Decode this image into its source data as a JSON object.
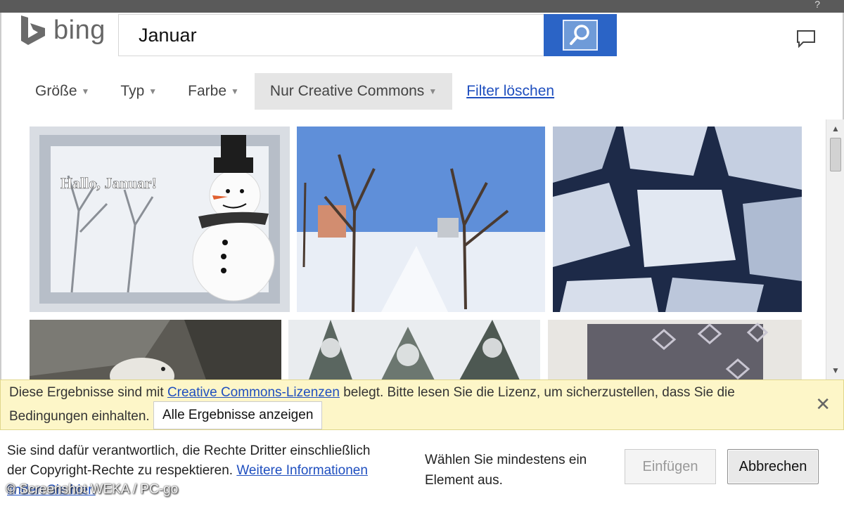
{
  "titlebar": {
    "help_icon": "question-mark-icon"
  },
  "logo": {
    "text": "bing",
    "icon": "bing-logo-mark"
  },
  "search": {
    "value": "Januar",
    "button_icon": "search-icon"
  },
  "header": {
    "feedback_icon": "speech-bubble-icon"
  },
  "filters": {
    "items": [
      {
        "label": "Größe"
      },
      {
        "label": "Typ"
      },
      {
        "label": "Farbe"
      },
      {
        "label": "Nur Creative Commons"
      }
    ],
    "clear_label": "Filter löschen"
  },
  "results": {
    "images": [
      {
        "alt": "Hallo, Januar!"
      },
      {
        "alt": ""
      },
      {
        "alt": ""
      },
      {
        "alt": ""
      },
      {
        "alt": ""
      },
      {
        "alt": ""
      }
    ]
  },
  "notice": {
    "text_before": "Diese Ergebnisse sind mit ",
    "link": "Creative Commons-Lizenzen",
    "text_after": " belegt. Bitte lesen Sie die Lizenz, um sicherzustellen, dass Sie die Bedingungen einhalten.",
    "show_all_label": "Alle Ergebnisse anzeigen",
    "close_icon": "close-icon"
  },
  "footer": {
    "legal_text": "Sie sind dafür verantwortlich, die Rechte Dritter einschließlich der Copyright-Rechte zu respektieren.",
    "legal_link": "Weitere Informationen finden Sie hier.",
    "select_hint": "Wählen Sie mindestens ein Element aus.",
    "insert_label": "Einfügen",
    "cancel_label": "Abbrechen",
    "watermark": "© Screenshot WEKA / PC-go"
  }
}
